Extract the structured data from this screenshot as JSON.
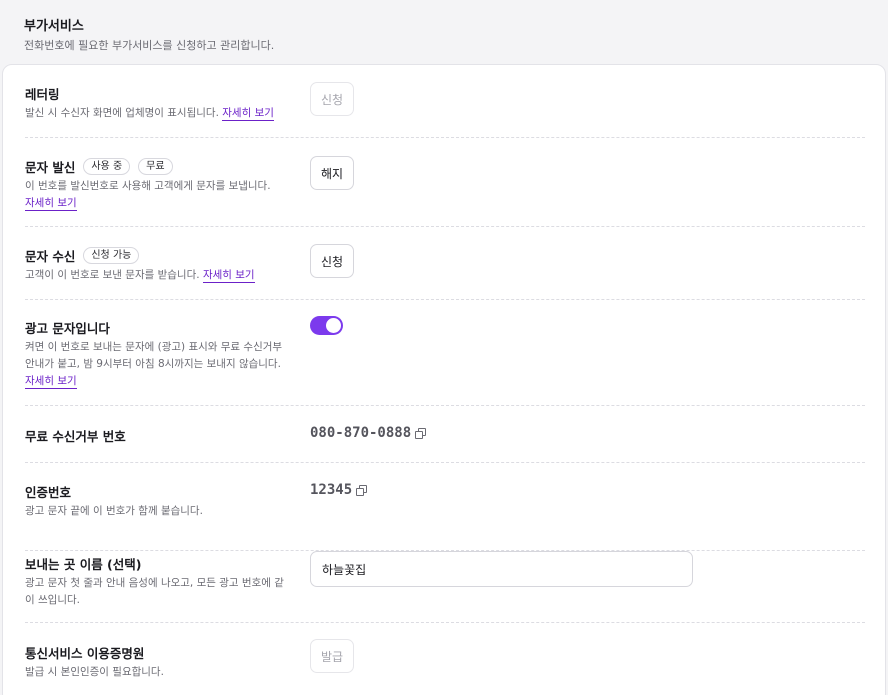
{
  "header": {
    "title": "부가서비스",
    "subtitle": "전화번호에 필요한 부가서비스를 신청하고 관리합니다."
  },
  "detail_link": "자세히 보기",
  "lettering": {
    "label": "레터링",
    "desc": "발신 시 수신자 화면에 업체명이 표시됩니다.",
    "button": "신청"
  },
  "sms_send": {
    "label": "문자 발신",
    "badges": [
      "사용 중",
      "무료"
    ],
    "desc": "이 번호를 발신번호로 사용해 고객에게 문자를 보냅니다.",
    "button": "해지"
  },
  "sms_receive": {
    "label": "문자 수신",
    "badge": "신청 가능",
    "desc": "고객이 이 번호로 보낸 문자를 받습니다.",
    "button": "신청"
  },
  "ad_sms": {
    "label": "광고 문자입니다",
    "desc_line1": "켜면 이 번호로 보내는 문자에 (광고) 표시와 무료 수신거부",
    "desc_line2": "안내가 붙고, 밤 9시부터 아침 8시까지는 보내지 않습니다.",
    "enabled": true,
    "accent_color": "#7c3aed"
  },
  "optout": {
    "label": "무료 수신거부 번호",
    "value": "080-870-0888",
    "icon": "copy-icon"
  },
  "auth_code": {
    "label": "인증번호",
    "desc": "광고 문자 끝에 이 번호가 함께 붙습니다.",
    "value": "12345",
    "icon": "copy-icon"
  },
  "sender_name": {
    "label": "보내는 곳 이름 (선택)",
    "desc_line1": "광고 문자 첫 줄과 안내 음성에 나오고, 모든 광고 번호에 같",
    "desc_line2": "이 쓰입니다.",
    "value": "하늘꽃집"
  },
  "certificate": {
    "label": "통신서비스 이용증명원",
    "desc": "발급 시 본인인증이 필요합니다.",
    "button": "발급"
  }
}
